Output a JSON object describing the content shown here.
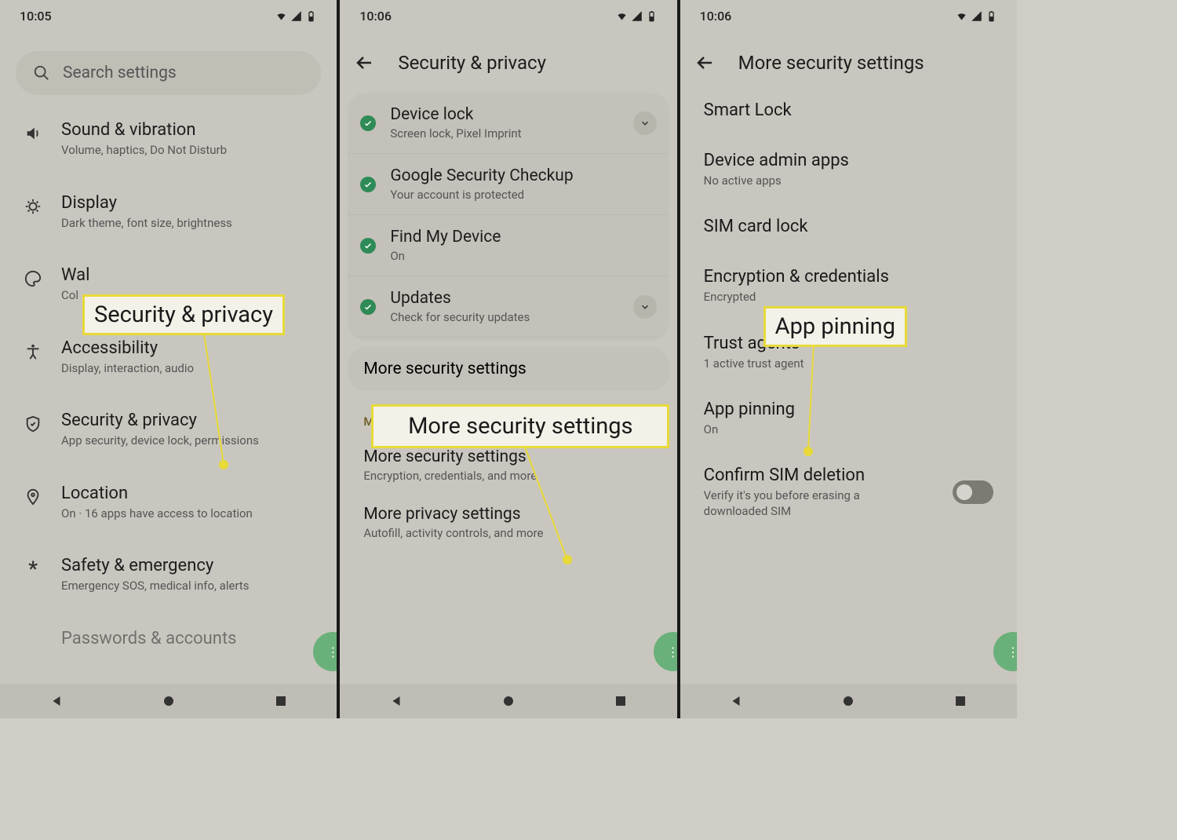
{
  "status": {
    "time1": "10:05",
    "time2": "10:06",
    "time3": "10:06"
  },
  "screen1": {
    "search_placeholder": "Search settings",
    "items": [
      {
        "title": "Sound & vibration",
        "sub": "Volume, haptics, Do Not Disturb"
      },
      {
        "title": "Display",
        "sub": "Dark theme, font size, brightness"
      },
      {
        "title": "Wal",
        "sub": "Col"
      },
      {
        "title": "Accessibility",
        "sub": "Display, interaction, audio"
      },
      {
        "title": "Security & privacy",
        "sub": "App security, device lock, permissions"
      },
      {
        "title": "Location",
        "sub": "On · 16 apps have access to location"
      },
      {
        "title": "Safety & emergency",
        "sub": "Emergency SOS, medical info, alerts"
      },
      {
        "title": "Passwords & accounts",
        "sub": ""
      }
    ],
    "callout": "Security & privacy"
  },
  "screen2": {
    "header": "Security & privacy",
    "rows": [
      {
        "title": "Device lock",
        "sub": "Screen lock, Pixel Imprint",
        "expand": true
      },
      {
        "title": "Google Security Checkup",
        "sub": "Your account is protected",
        "expand": false
      },
      {
        "title": "Find My Device",
        "sub": "On",
        "expand": false
      },
      {
        "title": "Updates",
        "sub": "Check for security updates",
        "expand": true
      }
    ],
    "card_last": "More security settings",
    "section_label": "More settings",
    "plain": [
      {
        "title": "More security settings",
        "sub": "Encryption, credentials, and more"
      },
      {
        "title": "More privacy settings",
        "sub": "Autofill, activity controls, and more"
      }
    ],
    "callout": "More security settings"
  },
  "screen3": {
    "header": "More security settings",
    "items": [
      {
        "title": "Smart Lock",
        "sub": ""
      },
      {
        "title": "Device admin apps",
        "sub": "No active apps"
      },
      {
        "title": "SIM card lock",
        "sub": ""
      },
      {
        "title": "Encryption & credentials",
        "sub": "Encrypted"
      },
      {
        "title": "Trust agents",
        "sub": "1 active trust agent"
      },
      {
        "title": "App pinning",
        "sub": "On"
      },
      {
        "title": "Confirm SIM deletion",
        "sub": "Verify it's you before erasing a downloaded SIM",
        "toggle": true
      }
    ],
    "callout": "App pinning"
  }
}
